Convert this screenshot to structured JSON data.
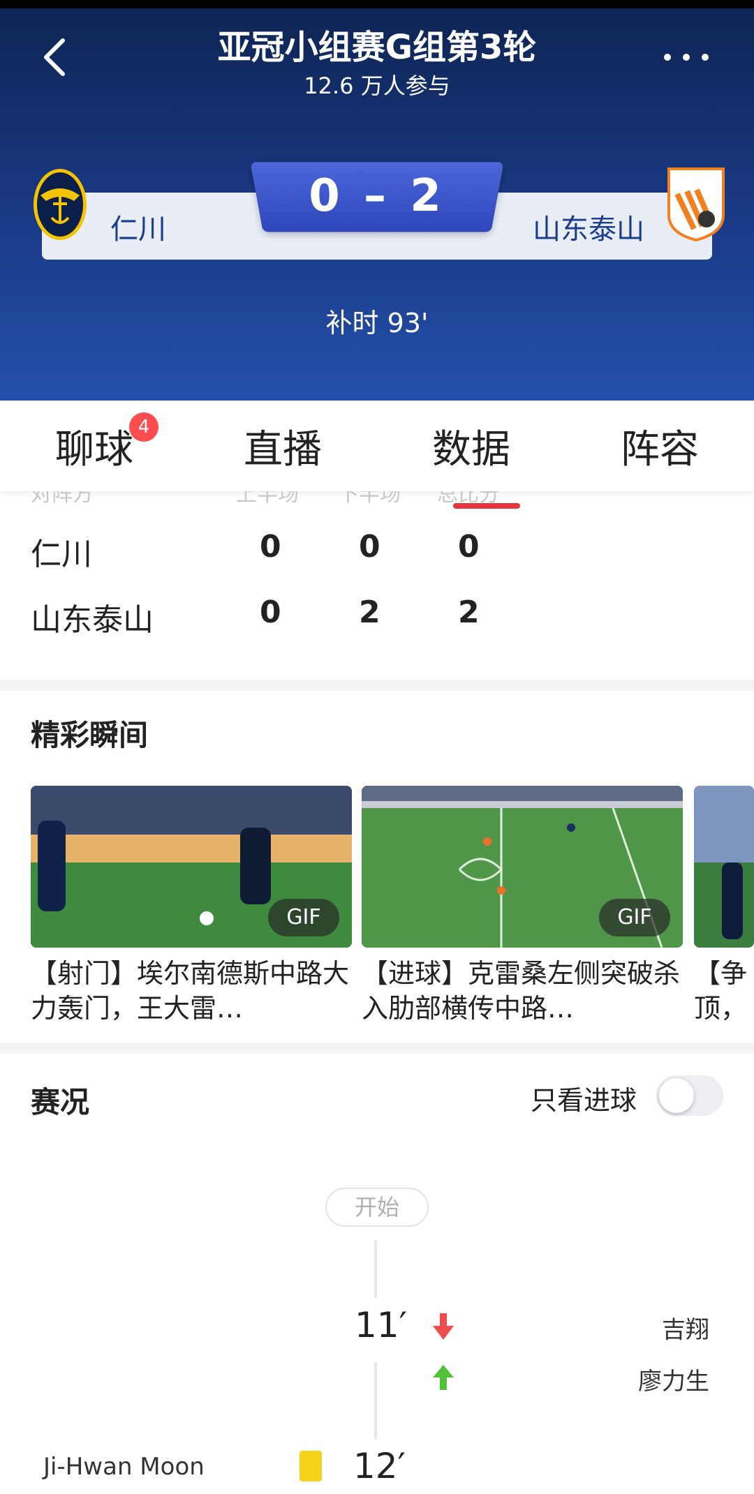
{
  "header": {
    "title": "亚冠小组赛G组第3轮",
    "participants": "12.6 万人参与",
    "home_team": "仁川",
    "away_team": "山东泰山",
    "score": "0 – 2",
    "match_time": "补时 93'"
  },
  "tabs": [
    {
      "label": "聊球",
      "badge": "4"
    },
    {
      "label": "直播"
    },
    {
      "label": "数据",
      "active": true
    },
    {
      "label": "阵容"
    }
  ],
  "score_table": {
    "header_fragments": [
      "对阵方",
      "上半场",
      "下半场",
      "总比分"
    ],
    "rows": [
      {
        "team": "仁川",
        "first_half": "0",
        "second_half": "0",
        "total": "0"
      },
      {
        "team": "山东泰山",
        "first_half": "0",
        "second_half": "2",
        "total": "2"
      }
    ]
  },
  "highlights": {
    "title": "精彩瞬间",
    "clips": [
      {
        "badge": "GIF",
        "caption": "【射门】埃尔南德斯中路大力轰门，王大雷…"
      },
      {
        "badge": "GIF",
        "caption": "【进球】克雷桑左侧突破杀入肋部横传中路…"
      },
      {
        "caption": "【争顶，"
      }
    ]
  },
  "events": {
    "title": "赛况",
    "goals_only_label": "只看进球",
    "goals_only_on": false,
    "start_label": "开始",
    "items": [
      {
        "minute": "11′",
        "type": "substitution",
        "out": "吉翔",
        "in": "廖力生"
      },
      {
        "minute": "12′",
        "type": "yellow-card",
        "player": "Ji-Hwan Moon"
      }
    ]
  },
  "colors": {
    "accent": "#e8323c",
    "hero_dark": "#0d2452",
    "hero_light": "#2450aa"
  }
}
